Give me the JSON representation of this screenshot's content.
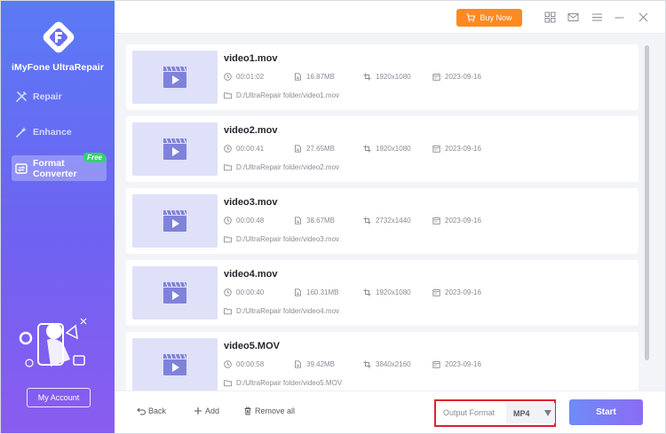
{
  "app": {
    "name": "iMyFone UltraRepair",
    "accent": "#6f62f2",
    "buy_color": "#ff8a1f"
  },
  "sidebar": {
    "items": [
      {
        "label": "Repair",
        "icon": "tools-icon",
        "active": false
      },
      {
        "label": "Enhance",
        "icon": "magic-wand-icon",
        "active": false
      },
      {
        "label": "Format Converter",
        "icon": "convert-icon",
        "active": true,
        "badge": "Free"
      }
    ],
    "account_label": "My Account"
  },
  "topbar": {
    "buy_label": "Buy Now",
    "icons": [
      "grid-icon",
      "mail-icon",
      "menu-icon",
      "minimize-icon",
      "close-icon"
    ]
  },
  "files": [
    {
      "name": "video1.mov",
      "duration": "00:01:02",
      "size": "16.87MB",
      "resolution": "1920x1080",
      "date": "2023-09-16",
      "path": "D:/UltraRepair folder/video1.mov"
    },
    {
      "name": "video2.mov",
      "duration": "00:00:41",
      "size": "27.65MB",
      "resolution": "1920x1080",
      "date": "2023-09-16",
      "path": "D:/UltraRepair folder/video2.mov"
    },
    {
      "name": "video3.mov",
      "duration": "00:00:48",
      "size": "38.67MB",
      "resolution": "2732x1440",
      "date": "2023-09-16",
      "path": "D:/UltraRepair folder/video3.mov"
    },
    {
      "name": "video4.mov",
      "duration": "00:00:40",
      "size": "160.31MB",
      "resolution": "1920x1080",
      "date": "2023-09-16",
      "path": "D:/UltraRepair folder/video4.mov"
    },
    {
      "name": "video5.MOV",
      "duration": "00:00:58",
      "size": "39.42MB",
      "resolution": "3840x2160",
      "date": "2023-09-16",
      "path": "D:/UltraRepair folder/video5.MOV"
    }
  ],
  "bottombar": {
    "back_label": "Back",
    "add_label": "Add",
    "remove_label": "Remove all",
    "format_label": "Output Format",
    "format_value": "MP4",
    "start_label": "Start"
  }
}
